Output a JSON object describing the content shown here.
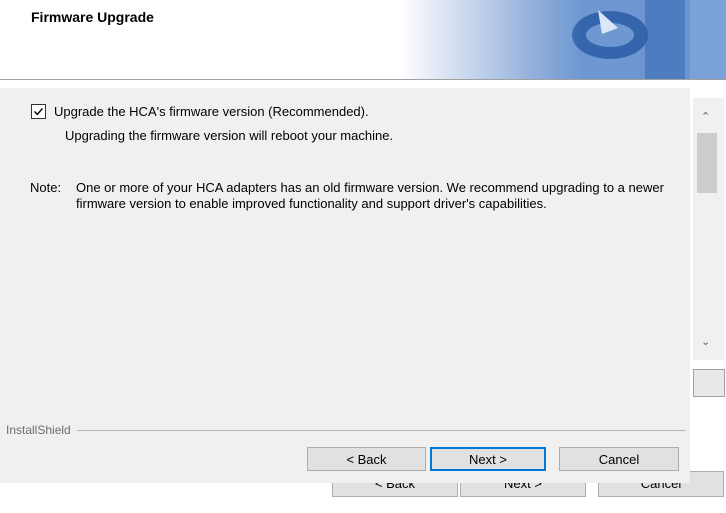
{
  "banner": {
    "title": "Firmware Upgrade"
  },
  "option": {
    "checked": true,
    "label": "Upgrade the HCA's firmware version (Recommended).",
    "sublabel": "Upgrading the firmware version will reboot your machine."
  },
  "note": {
    "key": "Note:",
    "text": "One or more of your HCA adapters has an old firmware version. We recommend upgrading to a newer firmware version to enable improved functionality and support driver's capabilities."
  },
  "footer": {
    "brand": "InstallShield"
  },
  "buttons": {
    "back": "< Back",
    "next": "Next >",
    "cancel": "Cancel"
  },
  "background_buttons": {
    "back": "< Back",
    "next": "Next >",
    "cancel": "Cancel"
  },
  "colors": {
    "accent": "#0078d7",
    "dialog_bg": "#f0f0f0",
    "banner_art": "#3a6db5"
  }
}
